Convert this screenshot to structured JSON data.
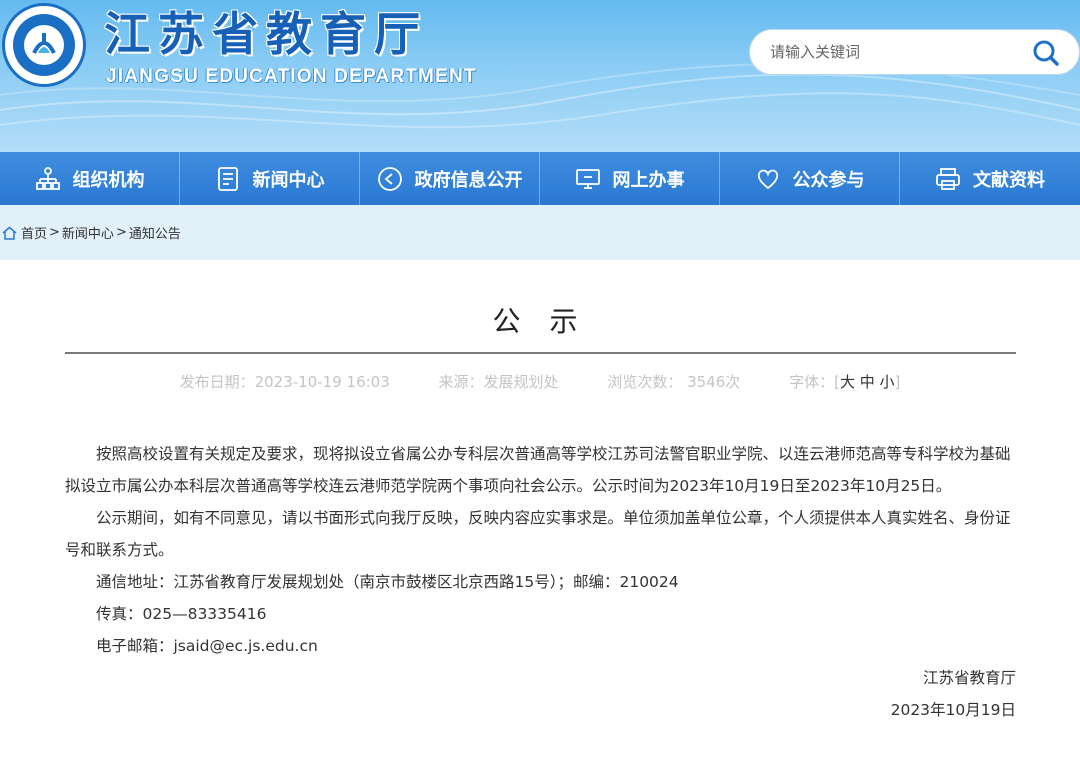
{
  "header": {
    "title": "江苏省教育厅",
    "subtitle": "JIANGSU EDUCATION DEPARTMENT",
    "search_placeholder": "请输入关键词",
    "brand_color": "#1760b8"
  },
  "nav": {
    "items": [
      {
        "label": "组织机构",
        "icon": "org-chart-icon"
      },
      {
        "label": "新闻中心",
        "icon": "document-icon"
      },
      {
        "label": "政府信息公开",
        "icon": "play-circle-icon"
      },
      {
        "label": "网上办事",
        "icon": "monitor-icon"
      },
      {
        "label": "公众参与",
        "icon": "heart-icon"
      },
      {
        "label": "文献资料",
        "icon": "printer-icon"
      }
    ]
  },
  "breadcrumb": {
    "home": "首页",
    "sep": ">",
    "level1": "新闻中心",
    "level2": "通知公告"
  },
  "article": {
    "title": "公 示",
    "meta": {
      "date": "发布日期：2023-10-19 16:03",
      "source": "来源：发展规划处",
      "views": "浏览次数：  3546次",
      "font_label": "字体：",
      "font_open": "[",
      "font_large": "大",
      "font_medium": "中",
      "font_small": "小",
      "font_close": "]"
    },
    "paragraphs": [
      "按照高校设置有关规定及要求，现将拟设立省属公办专科层次普通高等学校江苏司法警官职业学院、以连云港师范高等专科学校为基础拟设立市属公办本科层次普通高等学校连云港师范学院两个事项向社会公示。公示时间为2023年10月19日至2023年10月25日。",
      "公示期间，如有不同意见，请以书面形式向我厅反映，反映内容应实事求是。单位须加盖单位公章，个人须提供本人真实姓名、身份证号和联系方式。",
      "通信地址：江苏省教育厅发展规划处（南京市鼓楼区北京西路15号）；邮编：210024",
      "传真：025—83335416",
      "电子邮箱：jsaid@ec.js.edu.cn"
    ],
    "signature": "江苏省教育厅",
    "sign_date": "2023年10月19日"
  }
}
